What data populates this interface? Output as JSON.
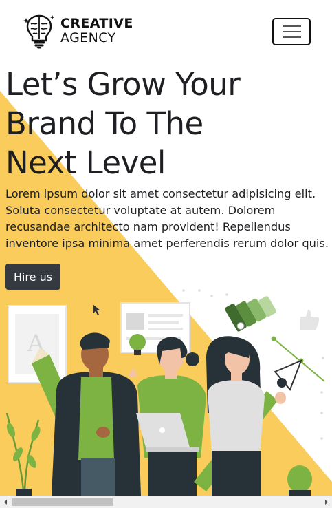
{
  "navbar": {
    "brand_line1": "CREATIVE",
    "brand_line2": "AGENCY",
    "toggler_icon": "hamburger-icon",
    "brand_icon": "brain-lightbulb-icon"
  },
  "hero": {
    "title_line1": "Let’s Grow Your",
    "title_line2": "Brand To The",
    "title_line3": "Next Level",
    "paragraph": "Lorem ipsum dolor sit amet consectetur adipisicing elit. Soluta consectetur voluptate at autem. Dolorem recusandae architecto nam provident! Repellendus inventore ipsa minima amet perferendis rerum dolor quis.",
    "cta_label": "Hire us"
  },
  "scrollbar": {
    "position": 0.0,
    "visible_fraction": 0.33
  },
  "colors": {
    "accent_yellow": "#f9cc5c",
    "illustration_green": "#7cb342",
    "button_dark": "#343a40",
    "text_dark": "#1e1f22"
  }
}
